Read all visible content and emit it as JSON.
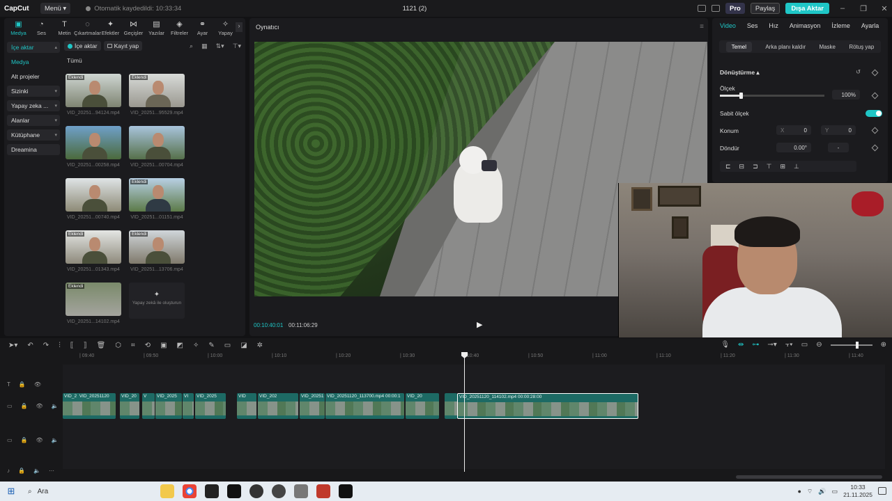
{
  "titlebar": {
    "app_name": "CapCut",
    "menu_label": "Menü",
    "autosave_text": "Otomatik kaydedildi: 10:33:34",
    "project_title": "1121 (2)",
    "pro_label": "Pro",
    "share_label": "Paylaş",
    "export_label": "Dışa Aktar"
  },
  "tool_tabs": [
    {
      "label": "Medya",
      "icon": "media-icon"
    },
    {
      "label": "Ses",
      "icon": "audio-icon"
    },
    {
      "label": "Metin",
      "icon": "text-icon"
    },
    {
      "label": "Çıkartmalar",
      "icon": "sticker-icon"
    },
    {
      "label": "Efektler",
      "icon": "effects-icon"
    },
    {
      "label": "Geçişler",
      "icon": "transitions-icon"
    },
    {
      "label": "Yazılar",
      "icon": "captions-icon"
    },
    {
      "label": "Filtreler",
      "icon": "filters-icon"
    },
    {
      "label": "Ayar",
      "icon": "adjust-icon"
    },
    {
      "label": "Yapay",
      "icon": "ai-icon"
    }
  ],
  "side_nav": [
    {
      "label": "İçe aktar",
      "chev": "▴"
    },
    {
      "label": "Medya",
      "chev": ""
    },
    {
      "label": "Alt projeler",
      "chev": ""
    },
    {
      "label": "Sizinki",
      "chev": "▾"
    },
    {
      "label": "Yapay zeka ...",
      "chev": "▾"
    },
    {
      "label": "Alanlar",
      "chev": "▾"
    },
    {
      "label": "Kütüphane",
      "chev": "▾"
    },
    {
      "label": "Dreamina",
      "chev": ""
    }
  ],
  "media": {
    "import_label": "İçe aktar",
    "record_label": "Kayıt yap",
    "all_label": "Tümü",
    "ai_create_label": "Yapay zekâ ile oluşturun",
    "items": [
      {
        "name": "VID_20251...94124.mp4",
        "badge": "Eklendi"
      },
      {
        "name": "VID_20251...95529.mp4",
        "badge": "Eklendi"
      },
      {
        "name": "VID_20251...00258.mp4",
        "badge": ""
      },
      {
        "name": "VID_20251...00704.mp4",
        "badge": ""
      },
      {
        "name": "VID_20251...00740.mp4",
        "badge": ""
      },
      {
        "name": "VID_20251...01151.mp4",
        "badge": "Eklendi"
      },
      {
        "name": "VID_20251...01343.mp4",
        "badge": "Eklendi"
      },
      {
        "name": "VID_20251...13706.mp4",
        "badge": "Eklendi"
      },
      {
        "name": "VID_20251...14102.mp4",
        "badge": "Eklendi"
      }
    ]
  },
  "player": {
    "title": "Oynatıcı",
    "current_time": "00:10:40:01",
    "total_time": "00:11:06:29"
  },
  "right_panel": {
    "tabs": [
      "Video",
      "Ses",
      "Hız",
      "Animasyon",
      "İzleme",
      "Ayarla"
    ],
    "sub_tabs": [
      "Temel",
      "Arka planı kaldır",
      "Maske",
      "Rötuş yap"
    ],
    "transform_label": "Dönüştürme",
    "scale_label": "Ölçek",
    "scale_value": "100%",
    "scale_fraction": 0.2,
    "uniform_scale_label": "Sabit ölçek",
    "position_label": "Konum",
    "pos_x_label": "X",
    "pos_x": "0",
    "pos_y_label": "Y",
    "pos_y": "0",
    "rotate_label": "Döndür",
    "rotate_value": "0.00°",
    "rotate_dash": "-"
  },
  "timeline": {
    "ruler": [
      "09:40",
      "09:50",
      "10:00",
      "10:10",
      "10:20",
      "10:30",
      "10:40",
      "10:50",
      "11:00",
      "11:10",
      "11:20",
      "11:30",
      "11:40"
    ],
    "clip_labels": [
      "VID_2",
      "VID_20251120",
      "VID_20",
      "V",
      "VID_2025",
      "VI",
      "VID_2025",
      "VID",
      "VID_202",
      "VID_20251",
      "VID_20251120_113700.mp4  00:00:1",
      "VID_20",
      "VID_20251120_114102.mp4   00:00:28:00"
    ]
  },
  "taskbar": {
    "search_label": "Ara",
    "time": "10:33",
    "date": "21.11.2025"
  }
}
